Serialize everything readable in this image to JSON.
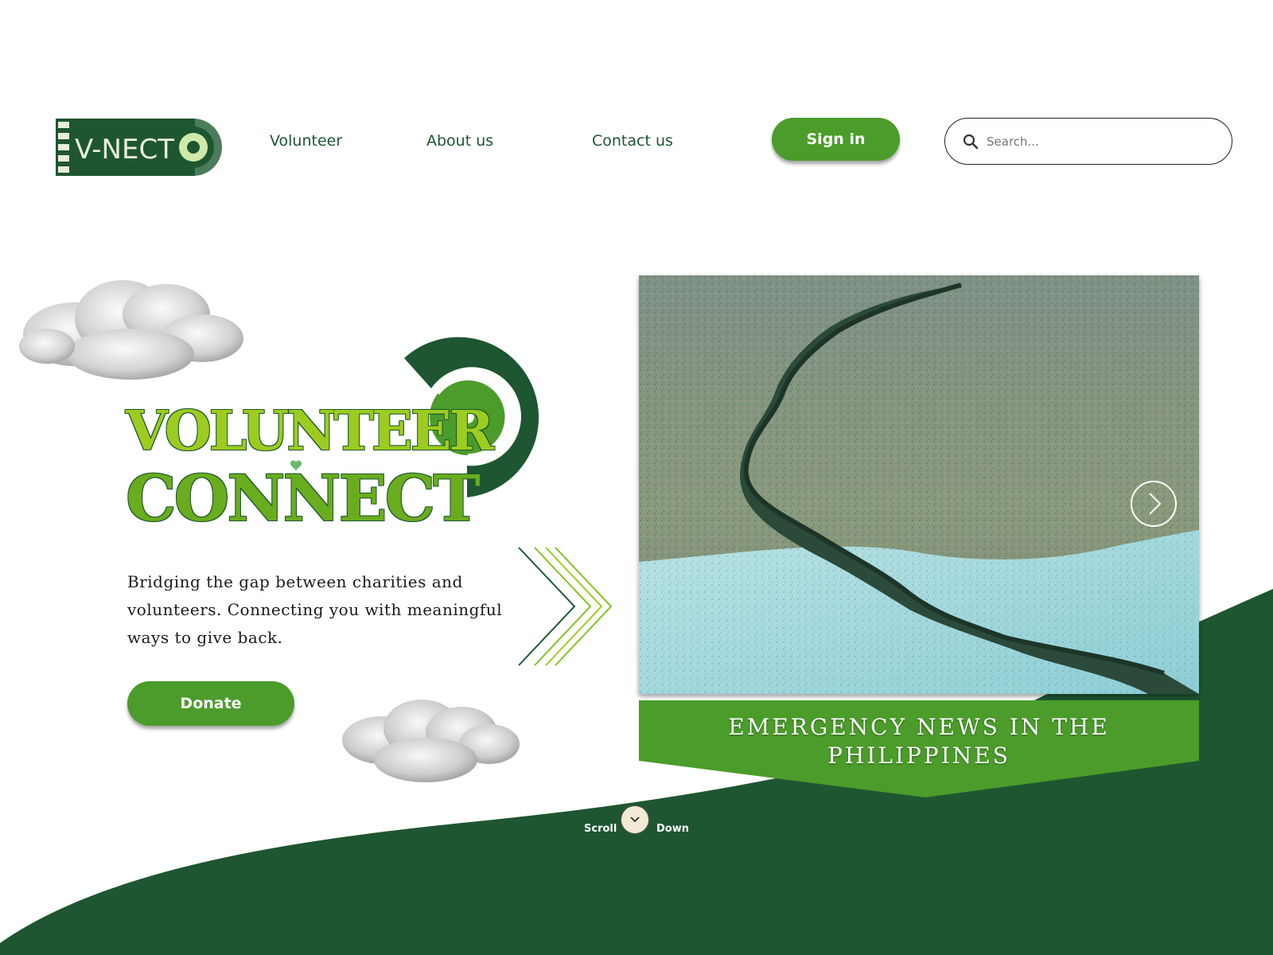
{
  "brand": {
    "logo_text": "V-NECT",
    "colors": {
      "dark_green": "#1e5631",
      "mid_green": "#4b9c2a",
      "lime": "#9ccc1f",
      "cream": "#f2ead3"
    }
  },
  "nav": {
    "links": [
      "Volunteer",
      "About us",
      "Contact us"
    ],
    "sign_in": "Sign in",
    "search_placeholder": "Search..."
  },
  "hero": {
    "title_line1": "VOLUNTEER",
    "title_line2": "CONNECT",
    "tagline": "Bridging the gap between charities and volunteers. Connecting you with meaningful ways to give back.",
    "donate": "Donate"
  },
  "news": {
    "caption": "EMERGENCY NEWS IN THE\nPHILIPPINES",
    "next_icon": "chevron-right-icon"
  },
  "scroll": {
    "left": "Scroll",
    "right": "Down",
    "icon": "chevron-down-icon"
  }
}
